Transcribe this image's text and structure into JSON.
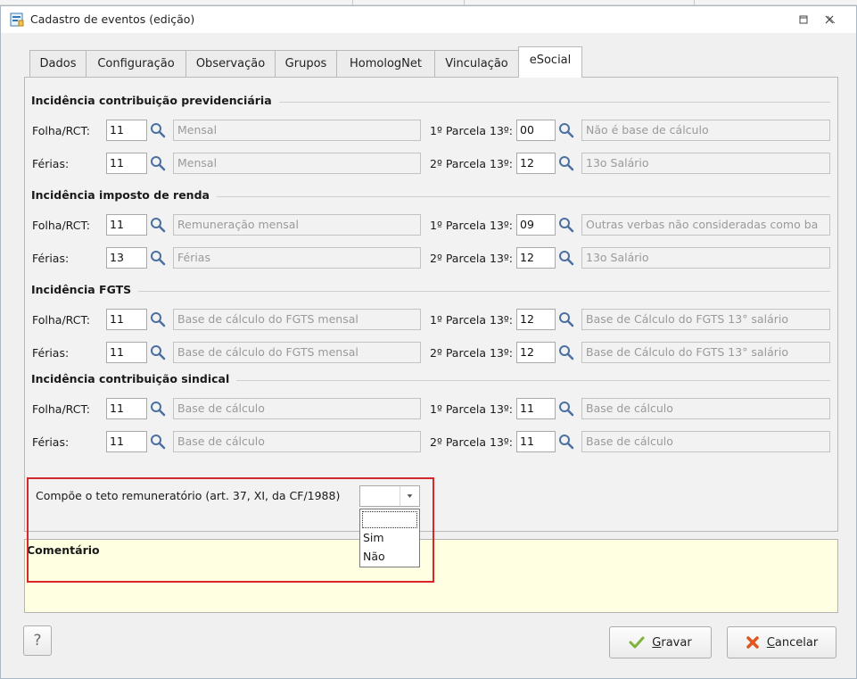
{
  "window": {
    "title": "Cadastro de eventos (edição)"
  },
  "tabs": [
    {
      "label": "Dados"
    },
    {
      "label": "Configuração"
    },
    {
      "label": "Observação"
    },
    {
      "label": "Grupos"
    },
    {
      "label": "HomologNet"
    },
    {
      "label": "Vinculação"
    },
    {
      "label": "eSocial"
    }
  ],
  "labels": {
    "folha": "Folha/RCT:",
    "ferias": "Férias:",
    "parcela1": "1º Parcela 13º:",
    "parcela2": "2º Parcela 13º:"
  },
  "sections": [
    {
      "title": "Incidência contribuição previdenciária",
      "rows": [
        {
          "code": "11",
          "desc": "Mensal",
          "parcela_code": "00",
          "parcela_desc": "Não é base de cálculo"
        },
        {
          "code": "11",
          "desc": "Mensal",
          "parcela_code": "12",
          "parcela_desc": "13o Salário"
        }
      ]
    },
    {
      "title": "Incidência imposto de renda",
      "rows": [
        {
          "code": "11",
          "desc": "Remuneração mensal",
          "parcela_code": "09",
          "parcela_desc": "Outras verbas não consideradas como ba"
        },
        {
          "code": "13",
          "desc": "Férias",
          "parcela_code": "12",
          "parcela_desc": "13o Salário"
        }
      ]
    },
    {
      "title": "Incidência FGTS",
      "rows": [
        {
          "code": "11",
          "desc": "Base de cálculo do FGTS mensal",
          "parcela_code": "12",
          "parcela_desc": "Base de Cálculo do FGTS 13° salário"
        },
        {
          "code": "11",
          "desc": "Base de cálculo do FGTS mensal",
          "parcela_code": "12",
          "parcela_desc": "Base de Cálculo do FGTS 13° salário"
        }
      ]
    },
    {
      "title": "Incidência contribuição sindical",
      "rows": [
        {
          "code": "11",
          "desc": "Base de cálculo",
          "parcela_code": "11",
          "parcela_desc": "Base de cálculo"
        },
        {
          "code": "11",
          "desc": "Base de cálculo",
          "parcela_code": "11",
          "parcela_desc": "Base de cálculo"
        }
      ]
    }
  ],
  "teto": {
    "label": "Compõe o teto remuneratório (art. 37, XI, da CF/1988)",
    "value": "",
    "options": [
      "",
      "Sim",
      "Não"
    ]
  },
  "comment": {
    "label": "Comentário"
  },
  "buttons": {
    "help": "?",
    "save_mnemonic": "G",
    "save_rest": "ravar",
    "cancel_mnemonic": "C",
    "cancel_rest": "ancelar"
  },
  "colors": {
    "accent_red": "#d62828",
    "comment_bg": "#ffffe1",
    "save_check": "#7fb33b",
    "cancel_x": "#e0561f"
  }
}
